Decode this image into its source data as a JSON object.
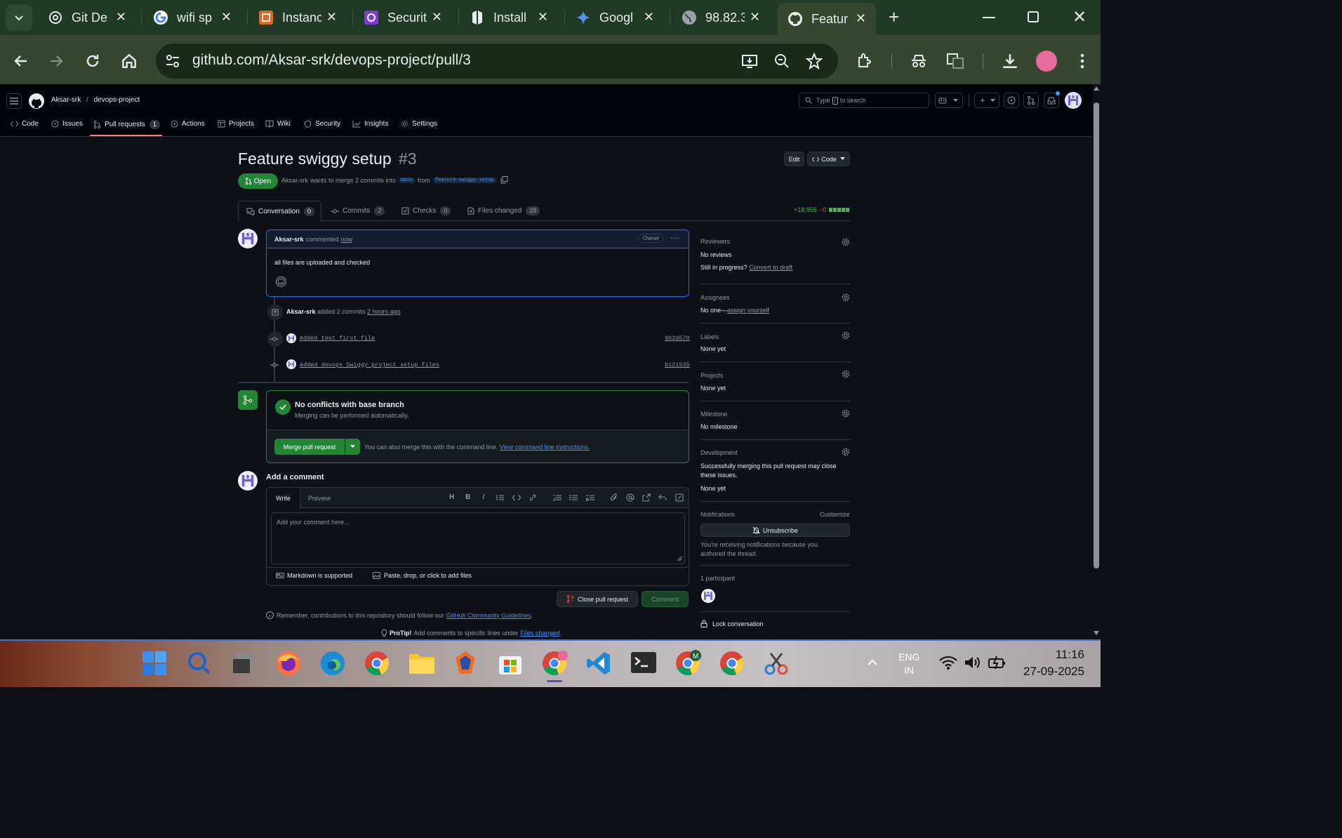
{
  "browser": {
    "tabs": [
      {
        "title": "Git De",
        "icon": "openai-icon"
      },
      {
        "title": "wifi sp",
        "icon": "google-icon"
      },
      {
        "title": "Instanc",
        "icon": "aws-icon"
      },
      {
        "title": "Securit",
        "icon": "security-app-icon"
      },
      {
        "title": "Install",
        "icon": "hashicorp-icon"
      },
      {
        "title": "Googl",
        "icon": "gemini-icon"
      },
      {
        "title": "98.82.3",
        "icon": "globe-icon"
      },
      {
        "title": "Featur",
        "icon": "github-icon",
        "active": true
      }
    ],
    "url": "github.com/Aksar-srk/devops-project/pull/3"
  },
  "github": {
    "owner": "Aksar-srk",
    "repo": "devops-project",
    "search_placeholder_pre": "Type",
    "search_key": "/",
    "search_placeholder_post": "to search",
    "nav": [
      {
        "label": "Code"
      },
      {
        "label": "Issues"
      },
      {
        "label": "Pull requests",
        "count": "1"
      },
      {
        "label": "Actions"
      },
      {
        "label": "Projects"
      },
      {
        "label": "Wiki"
      },
      {
        "label": "Security"
      },
      {
        "label": "Insights"
      },
      {
        "label": "Settings"
      }
    ]
  },
  "pr": {
    "title": "Feature swiggy setup",
    "number": "#3",
    "state": "Open",
    "author": "Aksar-srk",
    "merge_text": "wants to merge 2 commits into",
    "base": "main",
    "from": "from",
    "head": "feature-swiggy-setup",
    "edit": "Edit",
    "code": "Code",
    "tabs": [
      {
        "label": "Conversation",
        "count": "0"
      },
      {
        "label": "Commits",
        "count": "2"
      },
      {
        "label": "Checks",
        "count": "0"
      },
      {
        "label": "Files changed",
        "count": "28"
      }
    ],
    "additions": "+18,956",
    "deletions": "−0"
  },
  "comment": {
    "author": "Aksar-srk",
    "verb": "commented",
    "when": "now",
    "badge": "Owner",
    "body": "all files are uploaded and checked"
  },
  "timeline": {
    "author": "Aksar-srk",
    "text": "added 2 commits",
    "when": "2 hours ago",
    "commits": [
      {
        "message": "Added text first file",
        "sha": "9b2d570"
      },
      {
        "message": "Added devops Swiggy project setup files",
        "sha": "b121535"
      }
    ]
  },
  "merge": {
    "title": "No conflicts with base branch",
    "subtitle": "Merging can be performed automatically.",
    "button": "Merge pull request",
    "hint": "You can also merge this with the command line.",
    "link": "View command line instructions."
  },
  "add_comment": {
    "heading": "Add a comment",
    "tab_write": "Write",
    "tab_preview": "Preview",
    "placeholder": "Add your comment here...",
    "markdown": "Markdown is supported",
    "attach": "Paste, drop, or click to add files",
    "close_button": "Close pull request",
    "comment_button": "Comment",
    "remember": "Remember, contributions to this repository should follow our",
    "guidelines": "GitHub Community Guidelines",
    "protip_label": "ProTip!",
    "protip_text": "Add comments to specific lines under",
    "protip_link": "Files changed"
  },
  "sidebar": {
    "reviewers_h": "Reviewers",
    "reviewers_v": "No reviews",
    "progress_q": "Still in progress?",
    "progress_link": "Convert to draft",
    "assignees_h": "Assignees",
    "assignees_v": "No one—",
    "assignees_link": "assign yourself",
    "labels_h": "Labels",
    "labels_v": "None yet",
    "projects_h": "Projects",
    "projects_v": "None yet",
    "milestone_h": "Milestone",
    "milestone_v": "No milestone",
    "development_h": "Development",
    "development_text": "Successfully merging this pull request may close these issues.",
    "development_v": "None yet",
    "notifications_h": "Notifications",
    "customize": "Customize",
    "unsubscribe": "Unsubscribe",
    "notif_reason": "You're receiving notifications because you authored the thread.",
    "participants": "1 participant",
    "lock": "Lock conversation"
  },
  "taskbar": {
    "lang1": "ENG",
    "lang2": "IN",
    "time": "11:16",
    "date": "27-09-2025"
  }
}
